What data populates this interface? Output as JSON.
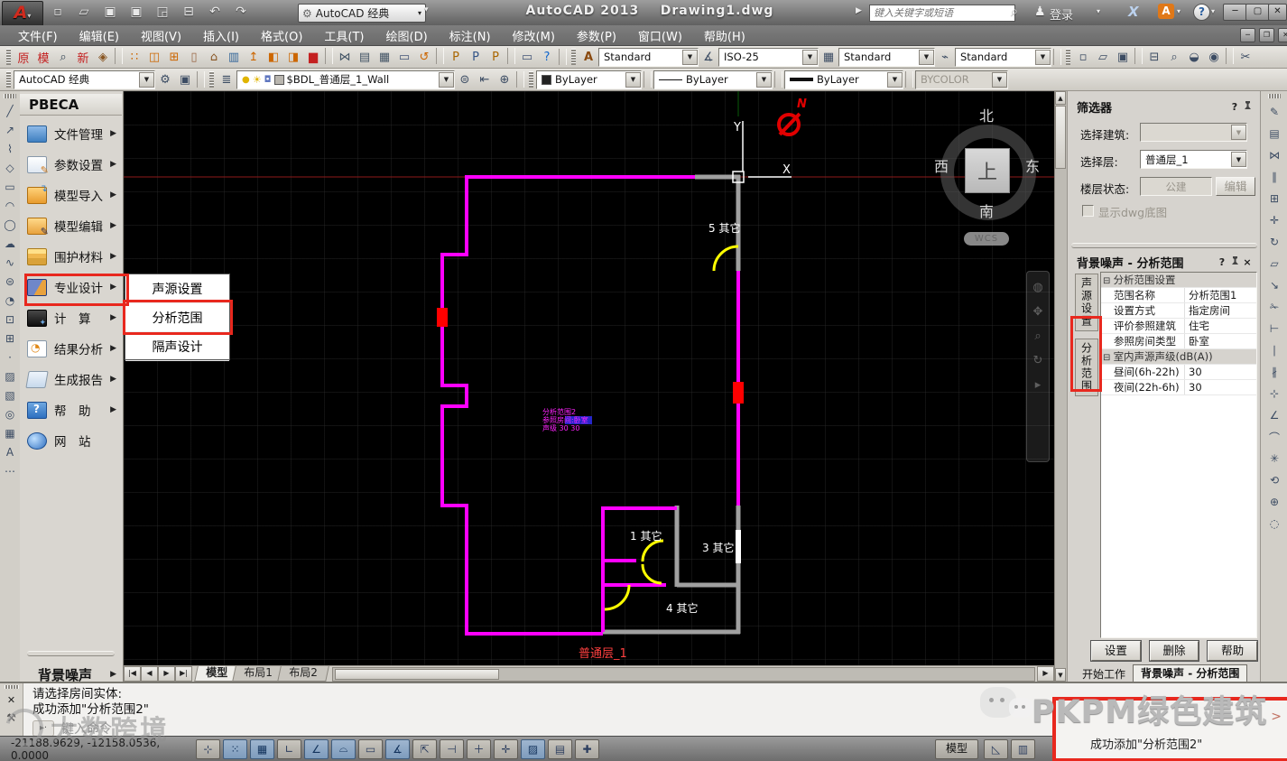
{
  "titlebar": {
    "workspace": "AutoCAD 经典",
    "app_title": "AutoCAD 2013",
    "doc_title": "Drawing1.dwg",
    "search_placeholder": "键入关键字或短语",
    "signin_label": "登录",
    "qat_icons": [
      {
        "name": "new-file-icon",
        "g": "▫"
      },
      {
        "name": "open-file-icon",
        "g": "▱"
      },
      {
        "name": "save-icon",
        "g": "▣"
      },
      {
        "name": "save-as-icon",
        "g": "▣"
      },
      {
        "name": "plot-icon",
        "g": "◲"
      },
      {
        "name": "print-icon",
        "g": "⊟"
      },
      {
        "name": "undo-icon",
        "g": "↶"
      },
      {
        "name": "redo-icon",
        "g": "↷"
      }
    ]
  },
  "menu": {
    "items": [
      "文件(F)",
      "编辑(E)",
      "视图(V)",
      "插入(I)",
      "格式(O)",
      "工具(T)",
      "绘图(D)",
      "标注(N)",
      "修改(M)",
      "参数(P)",
      "窗口(W)",
      "帮助(H)"
    ]
  },
  "toolbar_pkpm": {
    "icons": [
      {
        "name": "pkpm-original-icon",
        "g": "原",
        "c": "#c42020"
      },
      {
        "name": "pkpm-template-icon",
        "g": "模",
        "c": "#c42020"
      },
      {
        "name": "zoom-search-icon",
        "g": "⌕",
        "c": "#334455"
      },
      {
        "name": "pkpm-new-icon",
        "g": "新",
        "c": "#c42020"
      },
      {
        "name": "view-box-icon",
        "g": "◈",
        "c": "#885522"
      },
      {
        "sep": true
      },
      {
        "name": "grid-dots-icon",
        "g": "∷",
        "c": "#cc6600"
      },
      {
        "name": "door-icon",
        "g": "◫",
        "c": "#cc6600"
      },
      {
        "name": "window-icon",
        "g": "⊞",
        "c": "#cc6600"
      },
      {
        "name": "column-icon",
        "g": "▯",
        "c": "#996644"
      },
      {
        "name": "roof-icon",
        "g": "⌂",
        "c": "#885522"
      },
      {
        "name": "curtain-wall-icon",
        "g": "▥",
        "c": "#336699"
      },
      {
        "name": "lamp-icon",
        "g": "↥",
        "c": "#cc6600"
      },
      {
        "name": "door-frame-icon",
        "g": "◧",
        "c": "#cc6600"
      },
      {
        "name": "window-frame-icon",
        "g": "◨",
        "c": "#cc6600"
      },
      {
        "name": "wall-icon",
        "g": "▆",
        "c": "#c42020"
      },
      {
        "sep": true
      },
      {
        "name": "mirror-icon",
        "g": "⋈",
        "c": "#445566"
      },
      {
        "name": "copy-icon",
        "g": "▤",
        "c": "#445566"
      },
      {
        "name": "paste-icon",
        "g": "▦",
        "c": "#445566"
      },
      {
        "name": "screen-icon",
        "g": "▭",
        "c": "#445577"
      },
      {
        "name": "undo-orange-icon",
        "g": "↺",
        "c": "#cc6600"
      },
      {
        "sep": true
      },
      {
        "name": "folder-p1-icon",
        "g": "P",
        "c": "#aa6600"
      },
      {
        "name": "save-p-icon",
        "g": "P",
        "c": "#335588"
      },
      {
        "name": "folder-p2-icon",
        "g": "P",
        "c": "#aa6600"
      },
      {
        "sep": true
      },
      {
        "name": "display-icon",
        "g": "▭",
        "c": "#445577"
      },
      {
        "name": "help-blue-icon",
        "g": "?",
        "c": "#1166cc"
      }
    ]
  },
  "toolbar_styles": {
    "text_style_icon": "A",
    "text_style": "Standard",
    "dim_style_icon": "∡",
    "dim_style": "ISO-25",
    "table_style_icon": "▦",
    "table_style": "Standard",
    "mleader_style_icon": "⌁",
    "mleader_style": "Standard",
    "std_icons": [
      {
        "name": "new-file-icon",
        "g": "▫"
      },
      {
        "name": "open-file-icon",
        "g": "▱"
      },
      {
        "name": "save-file-icon",
        "g": "▣"
      },
      {
        "sep": true
      },
      {
        "name": "print-icon",
        "g": "⊟"
      },
      {
        "name": "preview-icon",
        "g": "⌕"
      },
      {
        "name": "publish-icon",
        "g": "◒"
      },
      {
        "name": "hyperlink-icon",
        "g": "◉"
      },
      {
        "sep": true
      },
      {
        "name": "cut-icon",
        "g": "✂"
      }
    ]
  },
  "toolbar_layers": {
    "workspace": "AutoCAD 经典",
    "layer_value": "$BDL_普通层_1_Wall",
    "color_value": "ByLayer",
    "linetype_value": "ByLayer",
    "lineweight_value": "ByLayer",
    "plotstyle_value": "BYCOLOR"
  },
  "draw_toolbar": {
    "icons": [
      {
        "name": "line-icon",
        "g": "╱"
      },
      {
        "name": "construction-line-icon",
        "g": "↗"
      },
      {
        "name": "polyline-icon",
        "g": "⌇"
      },
      {
        "name": "polygon-icon",
        "g": "◇"
      },
      {
        "name": "rectangle-icon",
        "g": "▭"
      },
      {
        "name": "arc-icon",
        "g": "◠"
      },
      {
        "name": "circle-icon",
        "g": "◯"
      },
      {
        "name": "revcloud-icon",
        "g": "☁"
      },
      {
        "name": "spline-icon",
        "g": "∿"
      },
      {
        "name": "ellipse-icon",
        "g": "⊜"
      },
      {
        "name": "ellipse-arc-icon",
        "g": "◔"
      },
      {
        "name": "insert-block-icon",
        "g": "⊡"
      },
      {
        "name": "create-block-icon",
        "g": "⊞"
      },
      {
        "name": "point-icon",
        "g": "·"
      },
      {
        "name": "hatch-icon",
        "g": "▨"
      },
      {
        "name": "gradient-icon",
        "g": "▧"
      },
      {
        "name": "region-icon",
        "g": "◎"
      },
      {
        "name": "table-icon",
        "g": "▦"
      },
      {
        "name": "mtext-icon",
        "g": "A"
      },
      {
        "name": "scale-list-icon",
        "g": "⋯"
      }
    ]
  },
  "modify_toolbar": {
    "icons": [
      {
        "name": "erase-icon",
        "g": "✎"
      },
      {
        "name": "copy-icon",
        "g": "▤"
      },
      {
        "name": "mirror-icon",
        "g": "⋈"
      },
      {
        "name": "offset-icon",
        "g": "∥"
      },
      {
        "name": "array-icon",
        "g": "⊞"
      },
      {
        "name": "move-icon",
        "g": "✛"
      },
      {
        "name": "rotate-icon",
        "g": "↻"
      },
      {
        "name": "scale-icon",
        "g": "▱"
      },
      {
        "name": "stretch-icon",
        "g": "↘"
      },
      {
        "name": "trim-icon",
        "g": "✁"
      },
      {
        "name": "extend-icon",
        "g": "⊢"
      },
      {
        "name": "break-point-icon",
        "g": "∣"
      },
      {
        "name": "break-icon",
        "g": "∦"
      },
      {
        "name": "join-icon",
        "g": "⊹"
      },
      {
        "name": "chamfer-icon",
        "g": "∠"
      },
      {
        "name": "fillet-icon",
        "g": "⌒"
      },
      {
        "name": "explode-icon",
        "g": "✳"
      },
      {
        "name": "blend-icon",
        "g": "⟲"
      },
      {
        "name": "align-icon",
        "g": "⊕"
      },
      {
        "name": "overkill-icon",
        "g": "◌"
      }
    ]
  },
  "pbeca": {
    "title": "PBECA",
    "items": [
      {
        "label": "文件管理",
        "ic": "folder",
        "arrow": true
      },
      {
        "label": "参数设置",
        "ic": "param",
        "arrow": true
      },
      {
        "label": "模型导入",
        "ic": "import",
        "arrow": true
      },
      {
        "label": "模型编辑",
        "ic": "edit",
        "arrow": true
      },
      {
        "label": "围护材料",
        "ic": "material",
        "arrow": true
      },
      {
        "label": "专业设计",
        "ic": "design",
        "arrow": true,
        "highlight": true
      },
      {
        "label": "计　算",
        "ic": "calc",
        "arrow": true
      },
      {
        "label": "结果分析",
        "ic": "result",
        "arrow": true
      },
      {
        "label": "生成报告",
        "ic": "report",
        "arrow": true
      },
      {
        "label": "帮　助",
        "ic": "help",
        "arrow": true
      },
      {
        "label": "网　站",
        "ic": "web",
        "arrow": false
      }
    ],
    "bottom_label": "背景噪声"
  },
  "submenu": {
    "items": [
      {
        "label": "声源设置"
      },
      {
        "label": "分析范围",
        "highlight": true
      },
      {
        "label": "隔声设计"
      }
    ]
  },
  "canvas": {
    "room5": "5 其它",
    "room1": "1 其它",
    "room3": "3 其它",
    "room4": "4 其它",
    "floor_label": "普通层_1",
    "north_letter": "N",
    "axis_x": "X",
    "axis_y": "Y",
    "compass": {
      "n": "北",
      "s": "南",
      "w": "西",
      "e": "东",
      "cube": "上",
      "wcs": "WCS"
    },
    "annotation": {
      "line1": "分析范围2",
      "line2": "参照房间:卧室",
      "line3": "声级 30 30"
    }
  },
  "layout_tabs": {
    "items": [
      {
        "label": "模型",
        "active": true
      },
      {
        "label": "布局1"
      },
      {
        "label": "布局2"
      }
    ]
  },
  "filter_panel": {
    "title": "筛选器",
    "help_icon": "?",
    "pin_icon": "-□",
    "building_label": "选择建筑:",
    "building_value": "",
    "layer_label": "选择层:",
    "layer_value": "普通层_1",
    "state_label": "楼层状态:",
    "state_value": "公建",
    "edit_button": "编辑",
    "dwg_checkbox_label": "显示dwg底图"
  },
  "noise_panel": {
    "title": "背景噪声 - 分析范围",
    "help_icon": "?",
    "close_icon": "×",
    "tabs": [
      {
        "label": "声源设置"
      },
      {
        "label": "分析范围",
        "highlight": true
      }
    ],
    "grid": [
      {
        "t": "group",
        "label": "分析范围设置"
      },
      {
        "t": "row",
        "label": "范围名称",
        "value": "分析范围1"
      },
      {
        "t": "row",
        "label": "设置方式",
        "value": "指定房间"
      },
      {
        "t": "row",
        "label": "评价参照建筑",
        "value": "住宅"
      },
      {
        "t": "row",
        "label": "参照房间类型",
        "value": "卧室"
      },
      {
        "t": "group",
        "label": "室内声源声级(dB(A))"
      },
      {
        "t": "row",
        "label": "昼间(6h-22h)",
        "value": "30"
      },
      {
        "t": "row",
        "label": "夜间(22h-6h)",
        "value": "30"
      }
    ],
    "buttons": [
      {
        "label": "设置"
      },
      {
        "label": "删除"
      },
      {
        "label": "帮助"
      }
    ],
    "bottom_tabs": [
      {
        "label": "开始工作"
      },
      {
        "label": "背景噪声 - 分析范围",
        "active": true
      }
    ]
  },
  "command": {
    "line1": "请选择房间实体:",
    "line2": "成功添加\"分析范围2\"",
    "prompt": "键入命令"
  },
  "statusbar": {
    "coords": "-21188.9629, -12158.0536, 0.0000",
    "model_label": "模型",
    "toggles": [
      {
        "name": "infer-constraints-icon",
        "g": "⊹"
      },
      {
        "name": "snap-icon",
        "g": "⁙",
        "pressed": true
      },
      {
        "name": "grid-icon",
        "g": "▦",
        "pressed": true
      },
      {
        "name": "ortho-icon",
        "g": "∟"
      },
      {
        "name": "polar-icon",
        "g": "∠",
        "pressed": true
      },
      {
        "name": "osnap-icon",
        "g": "⌓",
        "pressed": true
      },
      {
        "name": "otrack-icon",
        "g": "▭"
      },
      {
        "name": "ducs-icon",
        "g": "∡",
        "pressed": true
      },
      {
        "name": "dyn-icon",
        "g": "⇱"
      },
      {
        "name": "lwt-icon",
        "g": "⊣"
      },
      {
        "name": "tpy-icon",
        "g": "＋"
      },
      {
        "name": "qp-icon",
        "g": "✛"
      },
      {
        "name": "sc-icon",
        "g": "▨",
        "pressed": true
      },
      {
        "name": "layout-icon",
        "g": "▤"
      },
      {
        "name": "annoscale-icon",
        "g": "✚"
      }
    ],
    "layout_icons": [
      {
        "name": "quickview-drawings-icon",
        "g": "◺"
      },
      {
        "name": "quickview-layouts-icon",
        "g": "▥"
      }
    ]
  },
  "toast": {
    "text": "成功添加\"分析范围2\"",
    "chevron": ">"
  },
  "watermarks": {
    "pkpm": "PKPM绿色建筑",
    "bottom_left": "大数跨境"
  },
  "colors": {
    "accent_red": "#e8281e",
    "wall_magenta": "#ff00ff",
    "door_yellow": "#ffff00",
    "canvas_bg": "#000000",
    "panel_bg": "#d6d3ce"
  }
}
